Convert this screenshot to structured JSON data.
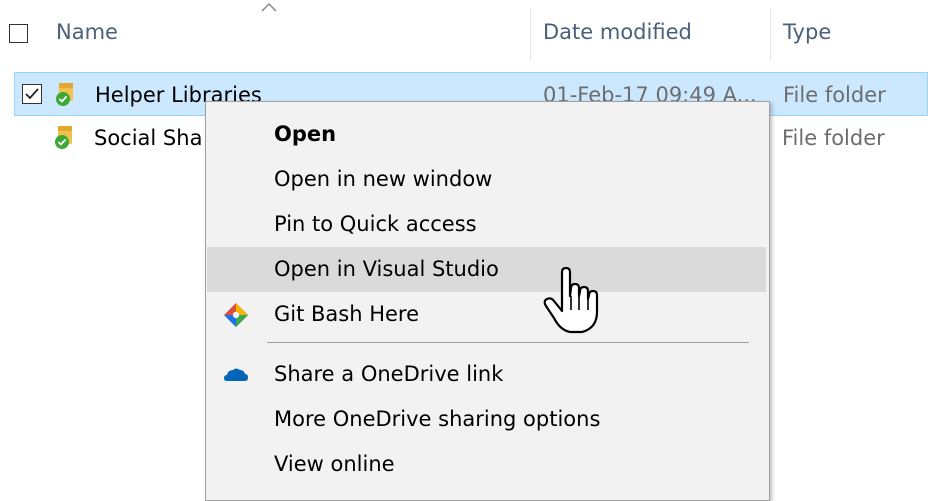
{
  "header": {
    "name_label": "Name",
    "date_label": "Date modified",
    "type_label": "Type",
    "sort_icon": "sort-up-caret"
  },
  "rows": [
    {
      "name": "Helper Libraries",
      "date": "01-Feb-17 09:49 A...",
      "type": "File folder",
      "selected": true,
      "checked": true,
      "icon": "synced-folder-icon"
    },
    {
      "name": "Social Sha",
      "date": "",
      "type": "File folder",
      "selected": false,
      "checked": false,
      "icon": "synced-folder-icon"
    }
  ],
  "context_menu": {
    "items": [
      {
        "label": "Open",
        "bold": true
      },
      {
        "label": "Open in new window"
      },
      {
        "label": "Pin to Quick access"
      },
      {
        "label": "Open in Visual Studio",
        "hovered": true
      },
      {
        "label": "Git Bash Here",
        "icon": "git-icon"
      },
      {
        "label": "Share a OneDrive link",
        "icon": "onedrive-icon"
      },
      {
        "label": "More OneDrive sharing options"
      },
      {
        "label": "View online"
      }
    ]
  },
  "colors": {
    "selection_bg": "#cce8ff",
    "selection_border": "#99d1ff",
    "menu_bg": "#f2f2f2",
    "menu_hover": "#dadada",
    "header_text": "#4c607a",
    "onedrive_blue": "#0364b8",
    "sync_green": "#3aa935"
  }
}
